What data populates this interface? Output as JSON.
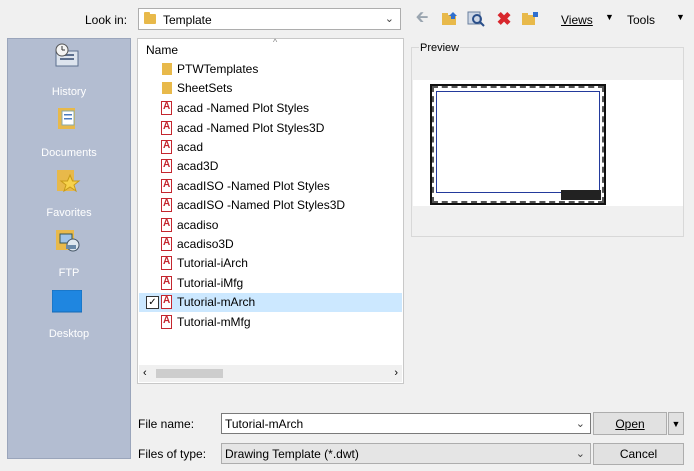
{
  "look_in": {
    "label": "Look in:",
    "value": "Template"
  },
  "toolbar": {
    "views_label": "Views",
    "tools_label": "Tools"
  },
  "places": [
    {
      "label": "History",
      "icon": "history-icon"
    },
    {
      "label": "Documents",
      "icon": "documents-icon"
    },
    {
      "label": "Favorites",
      "icon": "favorites-icon"
    },
    {
      "label": "FTP",
      "icon": "ftp-icon"
    },
    {
      "label": "Desktop",
      "icon": "desktop-icon"
    }
  ],
  "file_list": {
    "column_name": "Name",
    "items": [
      {
        "name": "PTWTemplates",
        "type": "folder"
      },
      {
        "name": "SheetSets",
        "type": "folder"
      },
      {
        "name": "acad -Named Plot Styles",
        "type": "dwt"
      },
      {
        "name": "acad -Named Plot Styles3D",
        "type": "dwt"
      },
      {
        "name": "acad",
        "type": "dwt"
      },
      {
        "name": "acad3D",
        "type": "dwt"
      },
      {
        "name": "acadISO -Named Plot Styles",
        "type": "dwt"
      },
      {
        "name": "acadISO -Named Plot Styles3D",
        "type": "dwt"
      },
      {
        "name": "acadiso",
        "type": "dwt"
      },
      {
        "name": "acadiso3D",
        "type": "dwt"
      },
      {
        "name": "Tutorial-iArch",
        "type": "dwt"
      },
      {
        "name": "Tutorial-iMfg",
        "type": "dwt"
      },
      {
        "name": "Tutorial-mArch",
        "type": "dwt",
        "selected": true
      },
      {
        "name": "Tutorial-mMfg",
        "type": "dwt"
      }
    ]
  },
  "preview": {
    "label": "Preview"
  },
  "file_name": {
    "label": "File name:",
    "value": "Tutorial-mArch"
  },
  "file_type": {
    "label": "Files of type:",
    "value": "Drawing Template (*.dwt)"
  },
  "buttons": {
    "open": "Open",
    "cancel": "Cancel"
  }
}
